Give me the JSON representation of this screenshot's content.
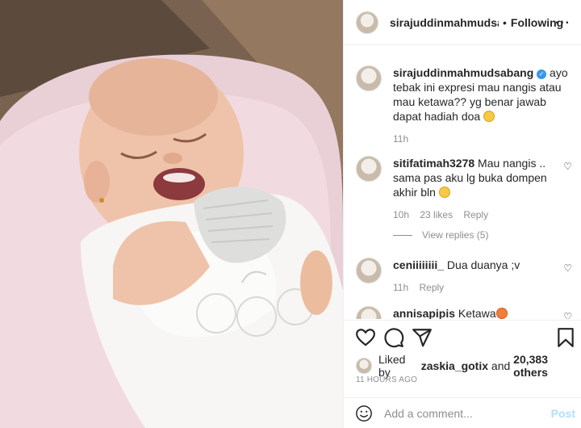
{
  "header": {
    "username": "sirajuddinmahmudsabang",
    "separator": "•",
    "follow_label": "Following"
  },
  "caption": {
    "username": "sirajuddinmahmudsabang",
    "text": " ayo tebak ini expresi mau nangis atau mau ketawa?? yg benar jawab dapat hadiah doa ",
    "time": "11h"
  },
  "comments": [
    {
      "username": "sitifatimah3278",
      "text": " Mau nangis .. sama pas aku lg buka dompen akhir bln ",
      "time": "10h",
      "likes": "23 likes",
      "reply": "Reply"
    },
    {
      "username": "ceniiiiiiii_",
      "text": " Dua duanya ;v",
      "time": "11h",
      "reply": "Reply"
    },
    {
      "username": "annisapipis",
      "text": " Ketawa"
    }
  ],
  "view_replies": "View replies (5)",
  "likes": {
    "prefix": "Liked by ",
    "user": "zaskia_gotix",
    "middle": " and ",
    "count": "20,383 others"
  },
  "time_ago": "11 HOURS AGO",
  "add_comment": {
    "placeholder": "Add a comment...",
    "post_label": "Post"
  },
  "colors": {
    "verified": "#3897f0",
    "post_disabled": "#b2dffc",
    "muted": "#8e8e8e"
  }
}
